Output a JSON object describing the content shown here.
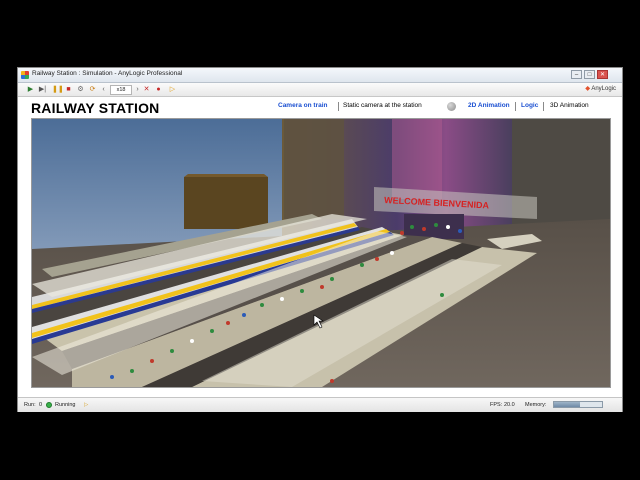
{
  "window": {
    "title": "Railway Station : Simulation - AnyLogic Professional",
    "buttons": {
      "minimize": "–",
      "maximize": "□",
      "close": "✕"
    }
  },
  "toolbar": {
    "speed": "x18",
    "logo_text": "AnyLogic",
    "icons": [
      "run-icon",
      "step-icon",
      "pause-icon",
      "stop-icon",
      "settings-icon",
      "refresh-icon",
      "speed-down-icon",
      "speed-up-icon",
      "go-icon"
    ]
  },
  "header": {
    "title": "RAILWAY STATION",
    "nav": [
      {
        "label": "Camera on train",
        "active": false
      },
      {
        "label": "Static camera at the station",
        "active": true
      },
      {
        "label": "2D Animation",
        "active": false
      },
      {
        "label": "Logic",
        "active": false
      },
      {
        "label": "3D Animation",
        "active": true
      }
    ]
  },
  "scene": {
    "sign_text": "WELCOME   BIENVENIDA",
    "colors": {
      "sky": "#5f7ba0",
      "ground": "#6d655c",
      "platform": "#cfcab4",
      "train_yellow": "#f1c21b",
      "sign": "#d62222"
    }
  },
  "status": {
    "run_label": "Run:",
    "run_value": "0",
    "state": "Running",
    "fps_label": "FPS:",
    "fps_value": "20.0",
    "memory_label": "Memory:",
    "memory_fraction": 0.55
  }
}
